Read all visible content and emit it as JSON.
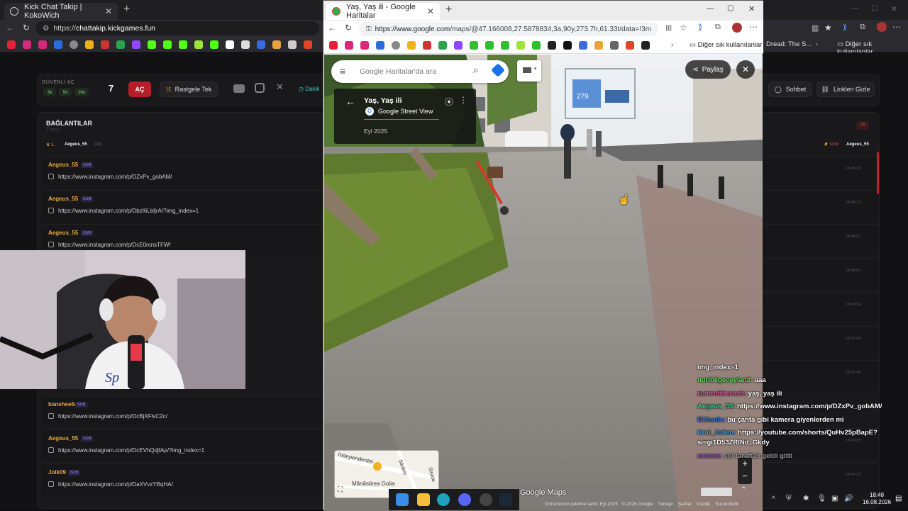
{
  "bg_browser": {
    "tab_title": "Kick Chat Takip | KokoWich",
    "url_prefix": "https://",
    "url_host": "chattakip.kickgames.fun",
    "bookmark_dread": "Dread: The S...",
    "bookmark_other": "Diğer sık kullanılanlar"
  },
  "dashboard": {
    "guvenli_label": "GÜVENLİ AÇ",
    "multipliers": [
      "3x",
      "5x",
      "10x"
    ],
    "count": "7",
    "ac_button": "AÇ",
    "random_button": "Rastgele Tek",
    "dakika_label": "Dakik",
    "sohbet_button": "Sohbet",
    "linkleri_gizle_button": "Linkleri Gizle",
    "baglantilar_title": "BAĞLANTILAR",
    "baglantilar_sub": "Tümü",
    "count_badge": "75",
    "first_rank": "1.",
    "first_user": "Aegeus_55",
    "first_count": "(10)",
    "son_label": "SON:",
    "son_user": "Aegeus_55",
    "entries": [
      {
        "user": "Aegeus_55",
        "badge": "SUB",
        "link": "https://www.instagram.com/p/DZxPv_gobAM/"
      },
      {
        "user": "Aegeus_55",
        "badge": "SUB",
        "link": "https://www.instagram.com/p/DbzI6LbljrA/?img_index=1"
      },
      {
        "user": "Aegeus_55",
        "badge": "SUB",
        "link": "https://www.instagram.com/p/DcE0rcnsTFW/"
      },
      {
        "user": "banshee64",
        "badge": "SUB",
        "link": "https://www.instagram.com/p/DcBjXFlvC2c/"
      },
      {
        "user": "Aegeus_55",
        "badge": "SUB",
        "link": "https://www.instagram.com/p/DcEVhQdjfAp/?img_index=1"
      },
      {
        "user": "Jolk09",
        "badge": "SUB",
        "link": "https://www.instagram.com/p/DaXVvzYBqHA/"
      }
    ],
    "times": [
      "18:48:26",
      "18:48:13",
      "18:48:02",
      "18:48:00",
      "18:47:54",
      "18:47:54",
      "18:47:48",
      "18:47:35",
      "18:47:32"
    ]
  },
  "maps_window": {
    "tab_title": "Yaş, Yaş ili - Google Haritalar",
    "url_host": "https://www.google.com",
    "url_rest": "/maps/@47.166008,27.5878834,3a,90y,273.7h,61.33t/data=!3m7!1e1!3",
    "bookmark_other": "Diğer sık kullanılanlar",
    "search_placeholder": "Google Haritalar'da ara",
    "share_button": "Paylaş",
    "place_title": "Yaş, Yaş ili",
    "street_view_label": "Google Street View",
    "date": "Eyl 2025",
    "billboard_price": "279",
    "minimap_labels": [
      "Independentei",
      "Sărărie",
      "Strada",
      "Mănăstirea Golia"
    ],
    "watermark": "Google Maps",
    "footer": [
      "Görüntünün çekilme tarihi: Eyl 2025",
      "© 2026 Google",
      "Türkiye",
      "Şartlar",
      "Gizlilik",
      "Sorun bildir"
    ]
  },
  "chat_overlay": [
    {
      "user": "",
      "text": "img_index=1",
      "user_color": "#ffffff"
    },
    {
      "user": "nuribilgeceylan2:",
      "text": "aaa",
      "user_color": "#5ee05e"
    },
    {
      "user": "zumruttherash:",
      "text": "yaş, yaş ili",
      "user_color": "#e0559a"
    },
    {
      "user": "Aegeus_55:",
      "text": "https://www.instagram.com/p/DZxPv_gobAM/",
      "user_color": "#3ccf9c"
    },
    {
      "user": "Bitkaala:",
      "text": "bu çanta gibi kamera giyenlerden mi",
      "user_color": "#3a7bd5"
    },
    {
      "user": "Kral_Julien:",
      "text": "https://youtube.com/shorts/QuHv25pBapE?",
      "user_color": "#3aa0e0"
    },
    {
      "user": "",
      "text": "si=gi1D53ZRlNd_Gkdy",
      "user_color": "#ffffff"
    },
    {
      "user": "xxxxxx:",
      "text": "sol taraftan geldi gitti",
      "user_color": "#8a4fd0"
    }
  ],
  "system_tray": {
    "time": "18:48",
    "date": "16.08.2026"
  }
}
